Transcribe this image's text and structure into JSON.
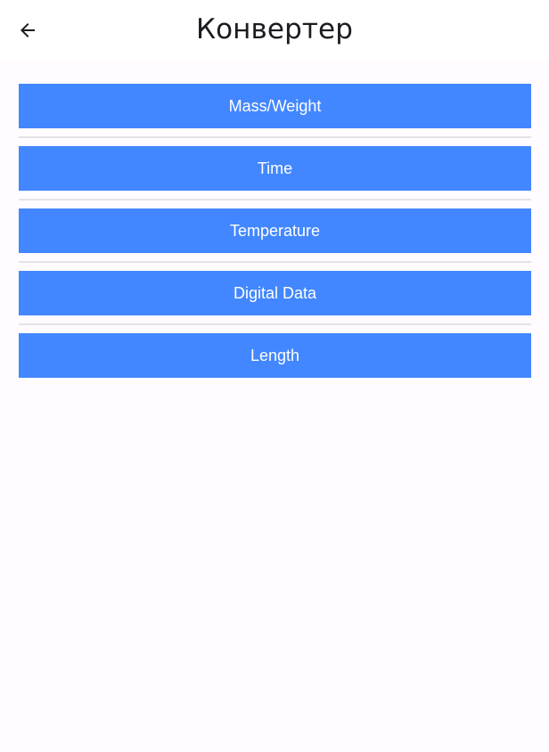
{
  "header": {
    "back_icon": "arrow-left-icon",
    "title": "Конвертер"
  },
  "converter_menu": {
    "buttons": [
      {
        "label": "Mass/Weight"
      },
      {
        "label": "Time"
      },
      {
        "label": "Temperature"
      },
      {
        "label": "Digital Data"
      },
      {
        "label": "Length"
      }
    ],
    "button_color": "#4287ff",
    "button_text_color": "#ffffff"
  },
  "theme": {
    "background": "#fffbfe",
    "app_bar_background": "#ffffff",
    "title_color": "#1d1b20"
  }
}
